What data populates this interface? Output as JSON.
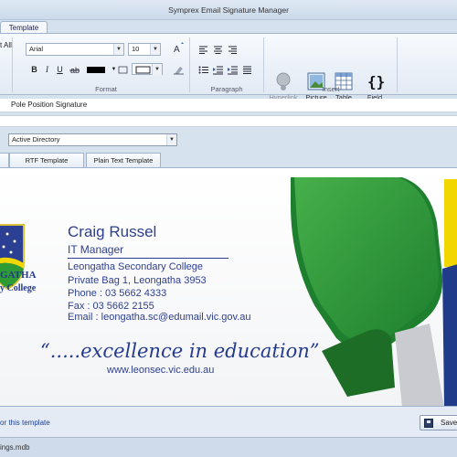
{
  "window": {
    "title": "Symprex Email Signature Manager"
  },
  "ribbon": {
    "tab_label": "Template",
    "all_label": "t All",
    "font_family": "Arial",
    "font_size": "10",
    "groups": {
      "format": "Format",
      "paragraph": "Paragraph",
      "insert": "Insert"
    },
    "format_buttons": {
      "bold": "B",
      "italic": "I",
      "underline": "U"
    },
    "insert_buttons": {
      "hyperlink": "Hyperlink",
      "picture": "Picture",
      "table": "Table",
      "field": "Field"
    }
  },
  "template": {
    "name": "Pole Position Signature",
    "data_source": "Active Directory",
    "tabs": [
      "RTF Template",
      "Plain Text Template"
    ]
  },
  "signature": {
    "name": "Craig Russel",
    "role": "IT Manager",
    "lines": [
      "Leongatha Secondary College",
      "Private Bag 1, Leongatha 3953",
      "Phone : 03 5662 4333",
      "Fax : 03 5662 2155",
      "Email : leongatha.sc@edumail.vic.gov.au"
    ],
    "motto": "“.....excellence in education”",
    "website": "www.leonsec.vic.edu.au",
    "school_crest_text_1": "GATHA",
    "school_crest_text_2": "y College"
  },
  "footer": {
    "link_text": "or this template",
    "save_label": "Save",
    "filename": "ings.mdb"
  },
  "colors": {
    "accent_blue": "#2d3f8e",
    "green": "#2e9b35",
    "yellow": "#f2d600",
    "navy": "#1f3b8a"
  }
}
